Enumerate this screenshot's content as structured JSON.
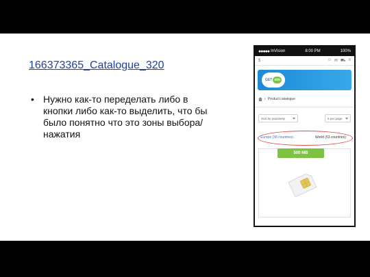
{
  "slide": {
    "title": "166373365_Catalogue_320",
    "bullet": "Нужно как-то переделать либо в кнопки либо как-то выделить, что бы было понятно что это зоны выбора/нажатия"
  },
  "phone": {
    "status": {
      "carrier": "InVision",
      "time": "8:00 PM",
      "battery": "100%"
    },
    "toolbar": {
      "left": "$ ·"
    },
    "logo": {
      "get": "GET",
      "sim": "sim"
    },
    "breadcrumb": "Product catalogue",
    "sort_select": "Sort by popularity",
    "per_page_select": "6 per page",
    "tab_europe": "Europe (38 countries)",
    "tab_world": "World (53 countries)",
    "amount": "500 MB"
  },
  "colors": {
    "accent": "#1f3ea8",
    "banner": "#1d8ad6",
    "green": "#7dc242",
    "highlight": "#e34a4a"
  }
}
